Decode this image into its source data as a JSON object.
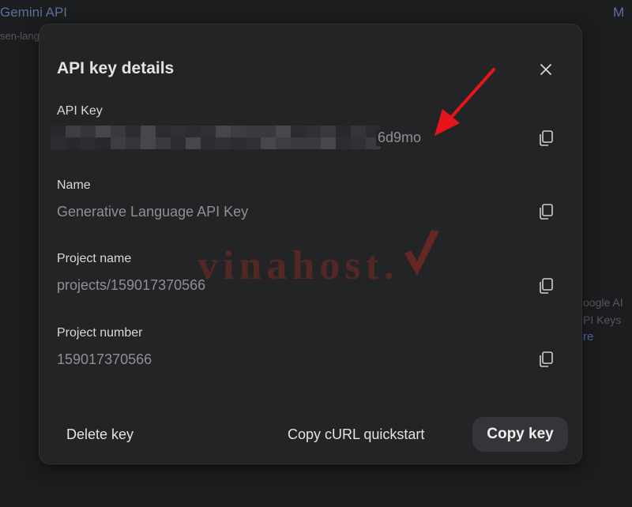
{
  "background": {
    "header_title": "Gemini API",
    "header_sub": "sen-lang",
    "right_label": "M",
    "right_text_1": "oogle AI",
    "right_text_2": "PI Keys",
    "right_link": "re"
  },
  "dialog": {
    "title": "API key details",
    "fields": [
      {
        "label": "API Key",
        "value": "6d9mo"
      },
      {
        "label": "Name",
        "value": "Generative Language API Key"
      },
      {
        "label": "Project name",
        "value": "projects/159017370566"
      },
      {
        "label": "Project number",
        "value": "159017370566"
      }
    ],
    "buttons": {
      "delete": "Delete key",
      "curl": "Copy cURL quickstart",
      "copy_key": "Copy key"
    }
  },
  "watermark": {
    "text": "vinahost."
  },
  "colors": {
    "dialog_bg": "#232426",
    "page_bg": "#1c1d1f",
    "accent_arrow": "#e8141b",
    "watermark": "#8a2a24"
  },
  "icons": [
    "close-icon",
    "copy-icon",
    "red-arrow-icon",
    "vinahost-logo"
  ]
}
